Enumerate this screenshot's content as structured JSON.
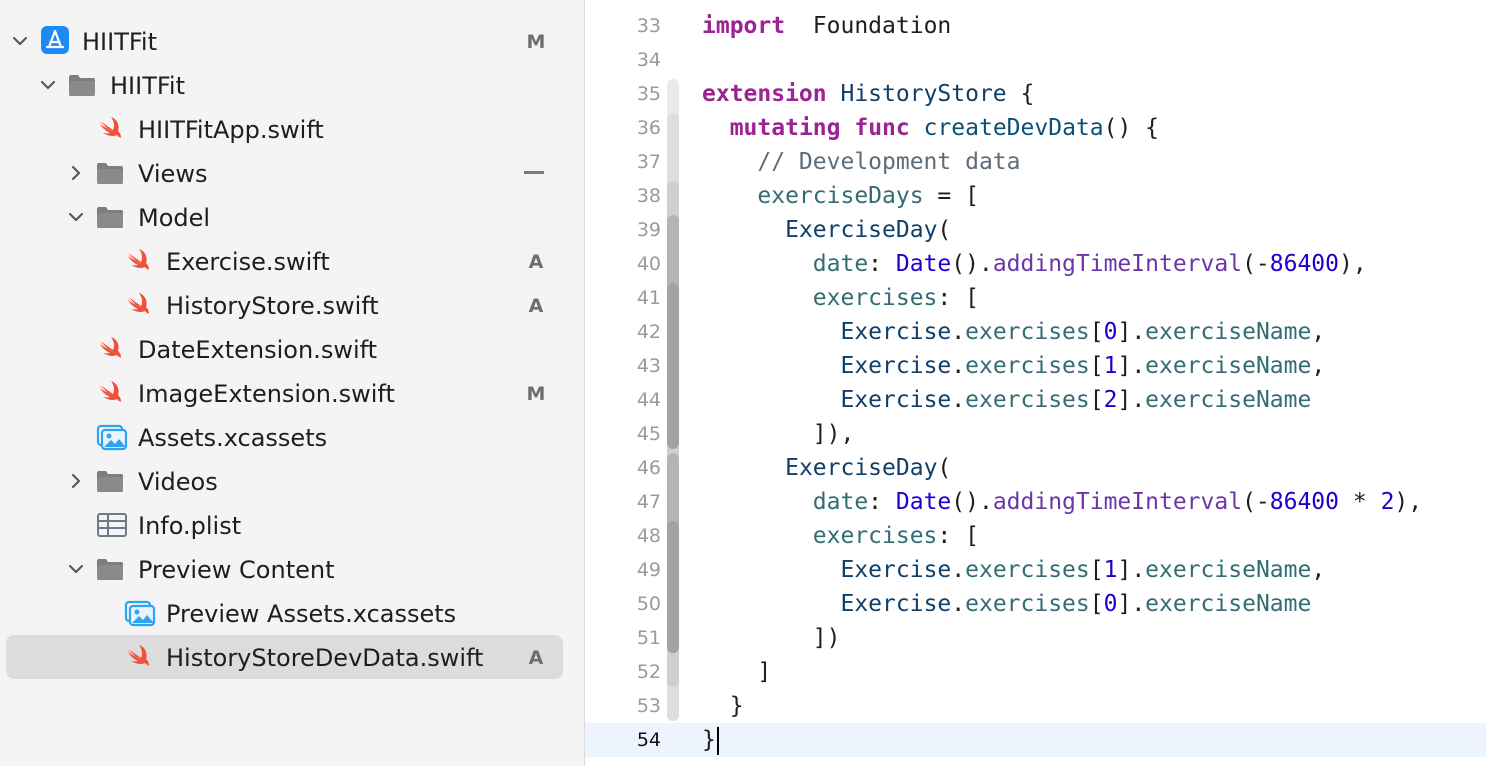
{
  "navigator": {
    "items": [
      {
        "label": "HIITFit",
        "status": "M",
        "icon": "app-icon",
        "chevron": "down"
      },
      {
        "label": "HIITFit",
        "status": "",
        "icon": "folder-icon",
        "chevron": "down"
      },
      {
        "label": "HIITFitApp.swift",
        "status": "",
        "icon": "swift-icon",
        "chevron": ""
      },
      {
        "label": "Views",
        "status": "–",
        "icon": "folder-icon",
        "chevron": "right"
      },
      {
        "label": "Model",
        "status": "",
        "icon": "folder-icon",
        "chevron": "down"
      },
      {
        "label": "Exercise.swift",
        "status": "A",
        "icon": "swift-icon",
        "chevron": ""
      },
      {
        "label": "HistoryStore.swift",
        "status": "A",
        "icon": "swift-icon",
        "chevron": ""
      },
      {
        "label": "DateExtension.swift",
        "status": "",
        "icon": "swift-icon",
        "chevron": ""
      },
      {
        "label": "ImageExtension.swift",
        "status": "M",
        "icon": "swift-icon",
        "chevron": ""
      },
      {
        "label": "Assets.xcassets",
        "status": "",
        "icon": "assets-icon",
        "chevron": ""
      },
      {
        "label": "Videos",
        "status": "",
        "icon": "folder-icon",
        "chevron": "right"
      },
      {
        "label": "Info.plist",
        "status": "",
        "icon": "plist-icon",
        "chevron": ""
      },
      {
        "label": "Preview Content",
        "status": "",
        "icon": "folder-icon",
        "chevron": "down"
      },
      {
        "label": "Preview Assets.xcassets",
        "status": "",
        "icon": "assets-icon",
        "chevron": ""
      },
      {
        "label": "HistoryStoreDevData.swift",
        "status": "A",
        "icon": "swift-icon",
        "chevron": ""
      }
    ],
    "selected_index": 14
  },
  "editor": {
    "current_line": 54,
    "lines": [
      {
        "n": "33",
        "tokens": [
          [
            "kw",
            "import"
          ],
          [
            "",
            "  Foundation"
          ]
        ]
      },
      {
        "n": "34",
        "tokens": []
      },
      {
        "n": "35",
        "tokens": [
          [
            "kw",
            "extension"
          ],
          [
            "",
            " "
          ],
          [
            "cls",
            "HistoryStore"
          ],
          [
            "",
            " {"
          ]
        ]
      },
      {
        "n": "36",
        "tokens": [
          [
            "",
            "  "
          ],
          [
            "kw",
            "mutating"
          ],
          [
            "",
            " "
          ],
          [
            "kw",
            "func"
          ],
          [
            "",
            " "
          ],
          [
            "ty2",
            "createDevData"
          ],
          [
            "",
            "() {"
          ]
        ]
      },
      {
        "n": "37",
        "tokens": [
          [
            "",
            "    "
          ],
          [
            "cm",
            "// Development data"
          ]
        ]
      },
      {
        "n": "38",
        "tokens": [
          [
            "",
            "    "
          ],
          [
            "pr",
            "exerciseDays"
          ],
          [
            "",
            " = ["
          ]
        ]
      },
      {
        "n": "39",
        "tokens": [
          [
            "",
            "      "
          ],
          [
            "cls",
            "ExerciseDay"
          ],
          [
            "",
            "("
          ]
        ]
      },
      {
        "n": "40",
        "tokens": [
          [
            "",
            "        "
          ],
          [
            "pr",
            "date"
          ],
          [
            "",
            ": "
          ],
          [
            "ty",
            "Date"
          ],
          [
            "",
            "()."
          ],
          [
            "me",
            "addingTimeInterval"
          ],
          [
            "",
            "(-"
          ],
          [
            "num",
            "86400"
          ],
          [
            "",
            "),"
          ]
        ]
      },
      {
        "n": "41",
        "tokens": [
          [
            "",
            "        "
          ],
          [
            "pr",
            "exercises"
          ],
          [
            "",
            ": ["
          ]
        ]
      },
      {
        "n": "42",
        "tokens": [
          [
            "",
            "          "
          ],
          [
            "cls",
            "Exercise"
          ],
          [
            "",
            "."
          ],
          [
            "pr",
            "exercises"
          ],
          [
            "",
            "["
          ],
          [
            "num",
            "0"
          ],
          [
            "",
            "]."
          ],
          [
            "pr",
            "exerciseName"
          ],
          [
            "",
            ","
          ]
        ]
      },
      {
        "n": "43",
        "tokens": [
          [
            "",
            "          "
          ],
          [
            "cls",
            "Exercise"
          ],
          [
            "",
            "."
          ],
          [
            "pr",
            "exercises"
          ],
          [
            "",
            "["
          ],
          [
            "num",
            "1"
          ],
          [
            "",
            "]."
          ],
          [
            "pr",
            "exerciseName"
          ],
          [
            "",
            ","
          ]
        ]
      },
      {
        "n": "44",
        "tokens": [
          [
            "",
            "          "
          ],
          [
            "cls",
            "Exercise"
          ],
          [
            "",
            "."
          ],
          [
            "pr",
            "exercises"
          ],
          [
            "",
            "["
          ],
          [
            "num",
            "2"
          ],
          [
            "",
            "]."
          ],
          [
            "pr",
            "exerciseName"
          ]
        ]
      },
      {
        "n": "45",
        "tokens": [
          [
            "",
            "        ]),"
          ]
        ]
      },
      {
        "n": "46",
        "tokens": [
          [
            "",
            "      "
          ],
          [
            "cls",
            "ExerciseDay"
          ],
          [
            "",
            "("
          ]
        ]
      },
      {
        "n": "47",
        "tokens": [
          [
            "",
            "        "
          ],
          [
            "pr",
            "date"
          ],
          [
            "",
            ": "
          ],
          [
            "ty",
            "Date"
          ],
          [
            "",
            "()."
          ],
          [
            "me",
            "addingTimeInterval"
          ],
          [
            "",
            "(-"
          ],
          [
            "num",
            "86400"
          ],
          [
            "",
            " * "
          ],
          [
            "num",
            "2"
          ],
          [
            "",
            "),"
          ]
        ]
      },
      {
        "n": "48",
        "tokens": [
          [
            "",
            "        "
          ],
          [
            "pr",
            "exercises"
          ],
          [
            "",
            ": ["
          ]
        ]
      },
      {
        "n": "49",
        "tokens": [
          [
            "",
            "          "
          ],
          [
            "cls",
            "Exercise"
          ],
          [
            "",
            "."
          ],
          [
            "pr",
            "exercises"
          ],
          [
            "",
            "["
          ],
          [
            "num",
            "1"
          ],
          [
            "",
            "]."
          ],
          [
            "pr",
            "exerciseName"
          ],
          [
            "",
            ","
          ]
        ]
      },
      {
        "n": "50",
        "tokens": [
          [
            "",
            "          "
          ],
          [
            "cls",
            "Exercise"
          ],
          [
            "",
            "."
          ],
          [
            "pr",
            "exercises"
          ],
          [
            "",
            "["
          ],
          [
            "num",
            "0"
          ],
          [
            "",
            "]."
          ],
          [
            "pr",
            "exerciseName"
          ]
        ]
      },
      {
        "n": "51",
        "tokens": [
          [
            "",
            "        ])"
          ]
        ]
      },
      {
        "n": "52",
        "tokens": [
          [
            "",
            "    ]"
          ]
        ]
      },
      {
        "n": "53",
        "tokens": [
          [
            "",
            "  }"
          ]
        ]
      },
      {
        "n": "54",
        "tokens": [
          [
            "",
            "}"
          ]
        ]
      }
    ]
  }
}
